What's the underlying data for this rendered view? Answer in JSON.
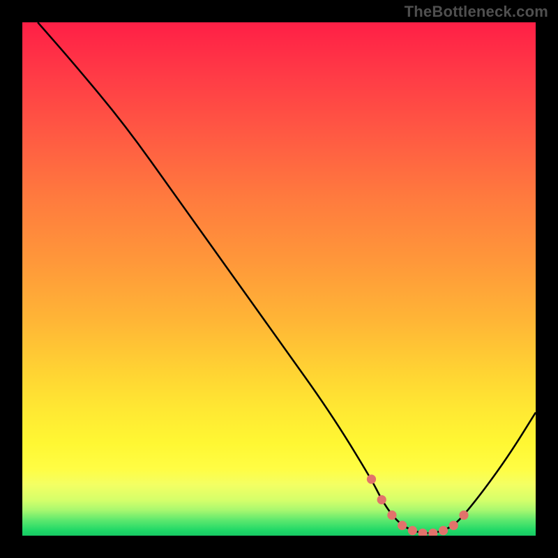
{
  "watermark": "TheBottleneck.com",
  "chart_data": {
    "type": "line",
    "title": "",
    "xlabel": "",
    "ylabel": "",
    "xlim": [
      0,
      100
    ],
    "ylim": [
      0,
      100
    ],
    "grid": false,
    "series": [
      {
        "name": "curve",
        "x": [
          3,
          10,
          20,
          30,
          40,
          50,
          60,
          68,
          70,
          72,
          74,
          76,
          78,
          80,
          82,
          84,
          86,
          90,
          95,
          100
        ],
        "y": [
          100,
          92,
          80,
          66,
          52,
          38,
          24,
          11,
          7,
          4,
          2,
          1,
          0.5,
          0.5,
          1,
          2,
          4,
          9,
          16,
          24
        ]
      },
      {
        "name": "valley-dots",
        "x": [
          68,
          70,
          72,
          74,
          76,
          78,
          80,
          82,
          84,
          86
        ],
        "y": [
          11,
          7,
          4,
          2,
          1,
          0.5,
          0.5,
          1,
          2,
          4
        ]
      }
    ],
    "gradient_stops": [
      {
        "pos": 0.0,
        "color": "#ff1f46"
      },
      {
        "pos": 0.1,
        "color": "#ff3a46"
      },
      {
        "pos": 0.22,
        "color": "#ff5a43"
      },
      {
        "pos": 0.34,
        "color": "#ff7a3e"
      },
      {
        "pos": 0.46,
        "color": "#ff963a"
      },
      {
        "pos": 0.58,
        "color": "#ffb536"
      },
      {
        "pos": 0.68,
        "color": "#ffd333"
      },
      {
        "pos": 0.75,
        "color": "#ffe733"
      },
      {
        "pos": 0.82,
        "color": "#fff733"
      },
      {
        "pos": 0.87,
        "color": "#fffd44"
      },
      {
        "pos": 0.9,
        "color": "#f4ff63"
      },
      {
        "pos": 0.93,
        "color": "#d6ff6a"
      },
      {
        "pos": 0.95,
        "color": "#a9f86f"
      },
      {
        "pos": 0.97,
        "color": "#5de86e"
      },
      {
        "pos": 0.99,
        "color": "#1fd867"
      },
      {
        "pos": 1.0,
        "color": "#17c964"
      }
    ],
    "colors": {
      "curve": "#000000",
      "dots": "#e2726b",
      "background_frame": "#000000"
    }
  }
}
